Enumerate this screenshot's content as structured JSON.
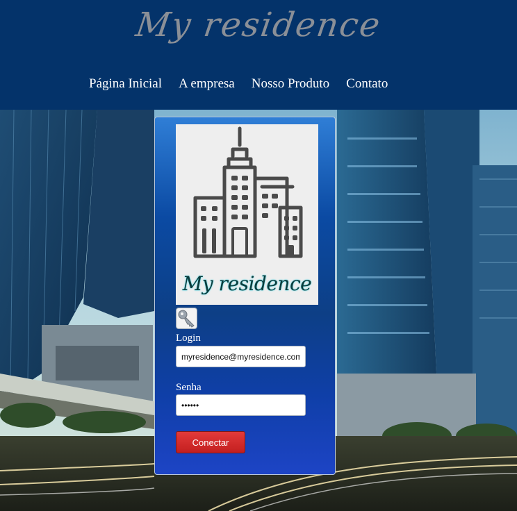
{
  "header": {
    "brand": "My residence",
    "nav": [
      {
        "label": "Página Inicial"
      },
      {
        "label": "A empresa"
      },
      {
        "label": "Nosso Produto"
      },
      {
        "label": "Contato"
      }
    ]
  },
  "login_panel": {
    "logo_text": "My residence",
    "login_label": "Login",
    "login_value": "myresidence@myresidence.com",
    "password_label": "Senha",
    "password_value": "123456",
    "submit_label": "Conectar"
  },
  "colors": {
    "header_bg": "#04336a",
    "button_red": "#d42e2e"
  }
}
